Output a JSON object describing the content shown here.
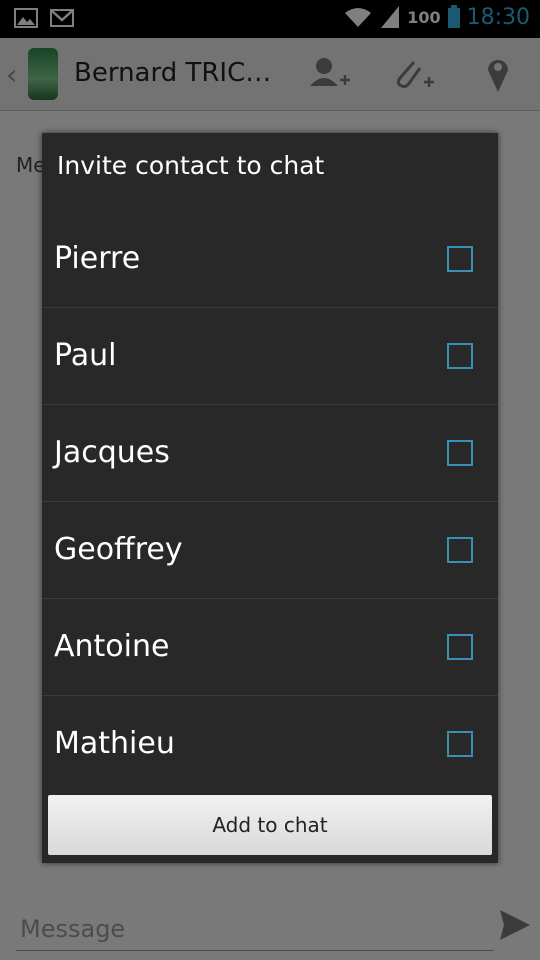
{
  "status_bar": {
    "time": "18:30",
    "battery": "100",
    "icons": [
      "gallery-icon",
      "gmail-icon",
      "wifi-icon",
      "signal-icon",
      "battery-icon"
    ]
  },
  "action_bar": {
    "contact_name": "Bernard TRIC…",
    "icons": [
      "add-contact-icon",
      "attach-icon",
      "location-icon"
    ]
  },
  "chat": {
    "partial_text": "Me"
  },
  "compose": {
    "placeholder": "Message"
  },
  "dialog": {
    "title": "Invite contact to chat",
    "contacts": [
      {
        "name": "Pierre",
        "checked": false
      },
      {
        "name": "Paul",
        "checked": false
      },
      {
        "name": "Jacques",
        "checked": false
      },
      {
        "name": "Geoffrey",
        "checked": false
      },
      {
        "name": "Antoine",
        "checked": false
      },
      {
        "name": "Mathieu",
        "checked": false
      }
    ],
    "button_label": "Add to chat"
  },
  "colors": {
    "accent": "#33b5e5",
    "dialog_bg": "#282828",
    "checkbox_border": "#3a8fb7"
  }
}
